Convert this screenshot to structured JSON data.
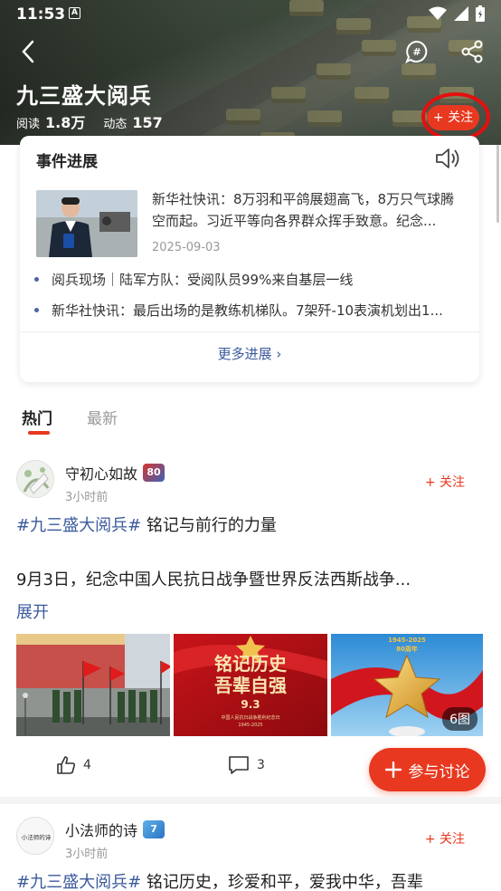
{
  "status_bar": {
    "time": "11:53",
    "a_icon": "A"
  },
  "header": {
    "title": "九三盛大阅兵",
    "read_label": "阅读",
    "read_count": "1.8万",
    "dynamic_label": "动态",
    "dynamic_count": "157",
    "follow_label": "+ 关注",
    "icons": [
      "back-icon",
      "comment-bubble-icon",
      "share-icon"
    ]
  },
  "event": {
    "heading": "事件进展",
    "main_text": "新华社快讯：8万羽和平鸽展翅高飞，8万只气球腾空而起。习近平等向各界群众挥手致意。纪念...",
    "date": "2025-09-03",
    "bullets": [
      "阅兵现场｜陆军方队：受阅队员99%来自基层一线",
      "新华社快讯：最后出场的是教练机梯队。7架歼-10表演机划出1..."
    ],
    "more_label": "更多进展 ›"
  },
  "tabs": {
    "hot": "热门",
    "new": "最新"
  },
  "posts": [
    {
      "author": "守初心如故",
      "badge": "80",
      "time": "3小时前",
      "follow": "+ 关注",
      "hashtag": "#九三盛大阅兵#",
      "title_rest": " 铭记与前行的力量",
      "body": "9月3日，纪念中国人民抗日战争暨世界反法西斯战争...",
      "expand": "展开",
      "image_text": {
        "img2_line1": "铭记历史",
        "img2_line2": "吾辈自强",
        "img2_date": "9.3",
        "img2_small": "中国人民抗日战争胜利纪念日",
        "img2_years": "1945-2025",
        "img3_years": "1945-2025",
        "img3_anniv": "80周年"
      },
      "image_count": "6图",
      "likes": "4",
      "comments": "3"
    },
    {
      "author": "小法师的诗",
      "avatar_text": "小法师的诗",
      "badge": "7",
      "time": "3小时前",
      "follow": "+ 关注",
      "hashtag": "#九三盛大阅兵#",
      "title_rest": " 铭记历史，珍爱和平，爱我中华，吾辈"
    }
  ],
  "fab_label": "参与讨论",
  "colors": {
    "accent": "#e8381f",
    "link": "#3a5a9c",
    "highlight_ring": "#e50f0f"
  }
}
